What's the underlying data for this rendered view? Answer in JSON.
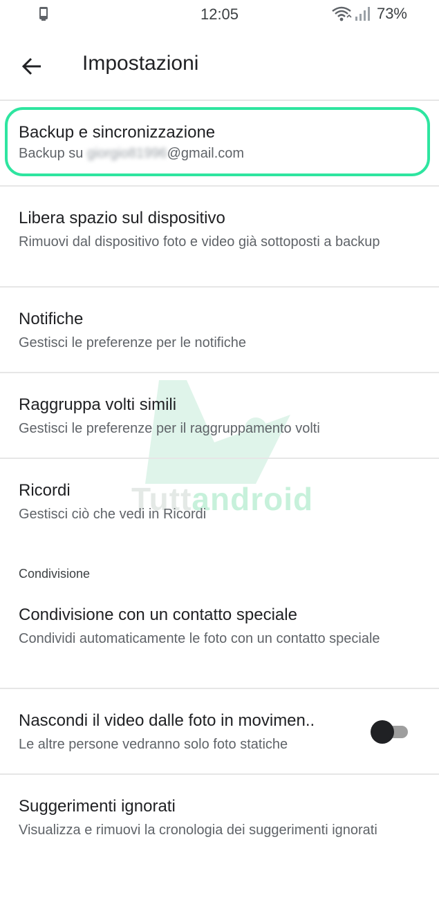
{
  "status_bar": {
    "time": "12:05",
    "battery": "73%"
  },
  "app_bar": {
    "title": "Impostazioni"
  },
  "items": [
    {
      "title": "Backup e sincronizzazione",
      "subtitle_prefix": "Backup su ",
      "subtitle_blurred": "giorgio81996",
      "subtitle_suffix": "@gmail.com"
    },
    {
      "title": "Libera spazio sul dispositivo",
      "subtitle": "Rimuovi dal dispositivo foto e video già sottoposti a backup"
    },
    {
      "title": "Notifiche",
      "subtitle": "Gestisci le preferenze per le notifiche"
    },
    {
      "title": "Raggruppa volti simili",
      "subtitle": "Gestisci le preferenze per il raggruppamento volti"
    },
    {
      "title": "Ricordi",
      "subtitle": "Gestisci ciò che vedi in Ricordi"
    },
    {
      "title": "Condivisione con un contatto speciale",
      "subtitle": "Condividi automaticamente le foto con un contatto speciale"
    },
    {
      "title": "Nascondi il video dalle foto in movimen..",
      "subtitle": "Le altre persone vedranno solo foto statiche"
    },
    {
      "title": "Suggerimenti ignorati",
      "subtitle": "Visualizza e rimuovi la cronologia dei suggerimenti ignorati"
    }
  ],
  "section_header": "Condivisione",
  "toggle": {
    "on": false
  },
  "watermark": {
    "part1": "Tutt",
    "part2": "android"
  },
  "colors": {
    "highlight": "#2ee5a0",
    "title_text": "#202124",
    "subtitle_text": "#5f6368",
    "divider": "#e6e6e6"
  },
  "icons": {
    "status_left": "notification-phone-icon",
    "wifi": "wifi-icon",
    "signal": "signal-icon",
    "back": "arrow-back-icon"
  }
}
